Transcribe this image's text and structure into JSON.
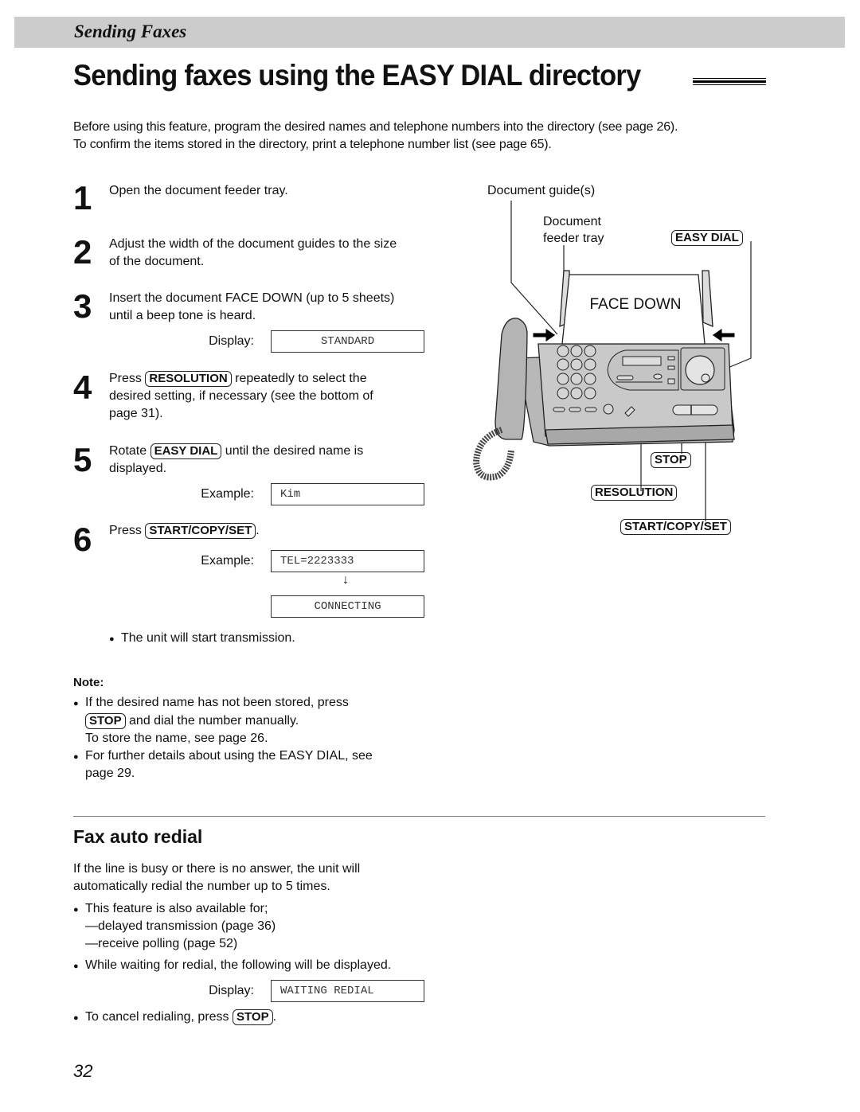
{
  "header": {
    "section": "Sending Faxes"
  },
  "title": "Sending faxes using the EASY DIAL directory",
  "intro": [
    "Before using this feature, program the desired names and telephone numbers into the directory (see page 26).",
    "To confirm the items stored in the directory, print a telephone number list (see page 65)."
  ],
  "steps": [
    {
      "num": "1",
      "lines": [
        "Open the document feeder tray."
      ]
    },
    {
      "num": "2",
      "lines": [
        "Adjust the width of the document guides to the size",
        "of the document."
      ]
    },
    {
      "num": "3",
      "lines": [
        "Insert the document FACE DOWN (up to 5 sheets)",
        "until a beep tone is heard."
      ],
      "display_label": "Display:",
      "display": "STANDARD"
    },
    {
      "num": "4",
      "pre": "Press",
      "key": "RESOLUTION",
      "post": "repeatedly to select the",
      "lines": [
        "desired setting, if necessary (see the bottom of",
        "page 31)."
      ]
    },
    {
      "num": "5",
      "pre": "Rotate",
      "key": "EASY DIAL",
      "post": "until the desired name is",
      "lines": [
        "displayed."
      ],
      "display_label": "Example:",
      "display": "Kim"
    },
    {
      "num": "6",
      "pre": "Press",
      "key": "START/COPY/SET",
      "post": ".",
      "display_label": "Example:",
      "display": "TEL=2223333",
      "display2": "CONNECTING",
      "arrow": "↓",
      "bullet": "The unit will start transmission."
    }
  ],
  "note": {
    "heading": "Note:",
    "items": [
      {
        "line1": "If the desired name has not been stored, press",
        "key": "STOP",
        "line2": "and dial the number manually.",
        "line3": "To store the name, see page 26."
      },
      {
        "line1": "For further details about using the EASY DIAL, see",
        "line2": "page 29."
      }
    ]
  },
  "redial": {
    "heading": "Fax auto redial",
    "para": [
      "If the line is busy or there is no answer, the unit will",
      "automatically redial the number up to 5 times."
    ],
    "bullet1": "This feature is also available for;",
    "sub": [
      "—delayed transmission (page 36)",
      "—receive polling (page 52)"
    ],
    "bullet2": "While waiting for redial, the following will be displayed.",
    "display_label": "Display:",
    "display": "WAITING REDIAL",
    "bullet3_pre": "To cancel redialing, press",
    "bullet3_key": "STOP",
    "bullet3_post": "."
  },
  "figure": {
    "label_guides": "Document guide(s)",
    "label_tray": [
      "Document",
      "feeder tray"
    ],
    "paper_text": "FACE DOWN",
    "key_easy_dial": "EASY DIAL",
    "key_stop": "STOP",
    "key_resolution": "RESOLUTION",
    "key_start": "START/COPY/SET"
  },
  "page_number": "32"
}
